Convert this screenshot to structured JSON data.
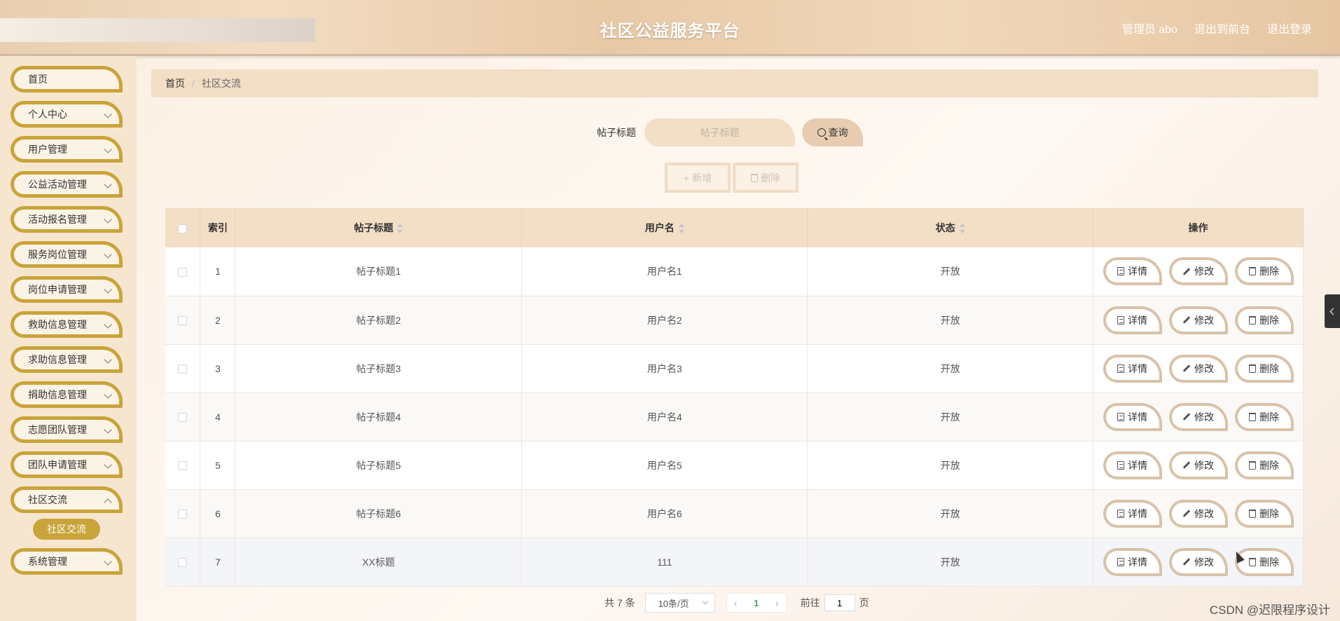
{
  "header": {
    "title": "社区公益服务平台",
    "user_label": "管理员 abo",
    "to_front": "退出到前台",
    "logout": "退出登录"
  },
  "sidebar": {
    "items": [
      {
        "label": "首页",
        "has_children": false
      },
      {
        "label": "个人中心",
        "has_children": true
      },
      {
        "label": "用户管理",
        "has_children": true
      },
      {
        "label": "公益活动管理",
        "has_children": true
      },
      {
        "label": "活动报名管理",
        "has_children": true
      },
      {
        "label": "服务岗位管理",
        "has_children": true
      },
      {
        "label": "岗位申请管理",
        "has_children": true
      },
      {
        "label": "救助信息管理",
        "has_children": true
      },
      {
        "label": "求助信息管理",
        "has_children": true
      },
      {
        "label": "捐助信息管理",
        "has_children": true
      },
      {
        "label": "志愿团队管理",
        "has_children": true
      },
      {
        "label": "团队申请管理",
        "has_children": true
      },
      {
        "label": "社区交流",
        "has_children": true,
        "expanded": true,
        "sub": "社区交流"
      },
      {
        "label": "系统管理",
        "has_children": true
      }
    ]
  },
  "breadcrumb": {
    "home": "首页",
    "sep": "/",
    "current": "社区交流"
  },
  "search": {
    "label": "帖子标题",
    "placeholder": "帖子标题",
    "button": "查询"
  },
  "actions": {
    "add": "新增",
    "delete": "删除"
  },
  "table": {
    "headers": {
      "index": "索引",
      "title": "帖子标题",
      "username": "用户名",
      "status": "状态",
      "ops": "操作"
    },
    "rows": [
      {
        "index": "1",
        "title": "帖子标题1",
        "username": "用户名1",
        "status": "开放"
      },
      {
        "index": "2",
        "title": "帖子标题2",
        "username": "用户名2",
        "status": "开放"
      },
      {
        "index": "3",
        "title": "帖子标题3",
        "username": "用户名3",
        "status": "开放"
      },
      {
        "index": "4",
        "title": "帖子标题4",
        "username": "用户名4",
        "status": "开放"
      },
      {
        "index": "5",
        "title": "帖子标题5",
        "username": "用户名5",
        "status": "开放"
      },
      {
        "index": "6",
        "title": "帖子标题6",
        "username": "用户名6",
        "status": "开放"
      },
      {
        "index": "7",
        "title": "XX标题",
        "username": "111",
        "status": "开放"
      }
    ],
    "op_labels": {
      "detail": "详情",
      "edit": "修改",
      "delete": "删除"
    }
  },
  "pager": {
    "total": "共 7 条",
    "page_size": "10条/页",
    "current_page": "1",
    "goto_prefix": "前往",
    "goto_value": "1",
    "goto_suffix": "页"
  },
  "watermark": "CSDN @迟限程序设计",
  "colors": {
    "accent": "#c9a43a",
    "header_bg": "#e9cfb0",
    "table_header_bg": "#f2dfc6",
    "page_active": "#4aa06b"
  }
}
